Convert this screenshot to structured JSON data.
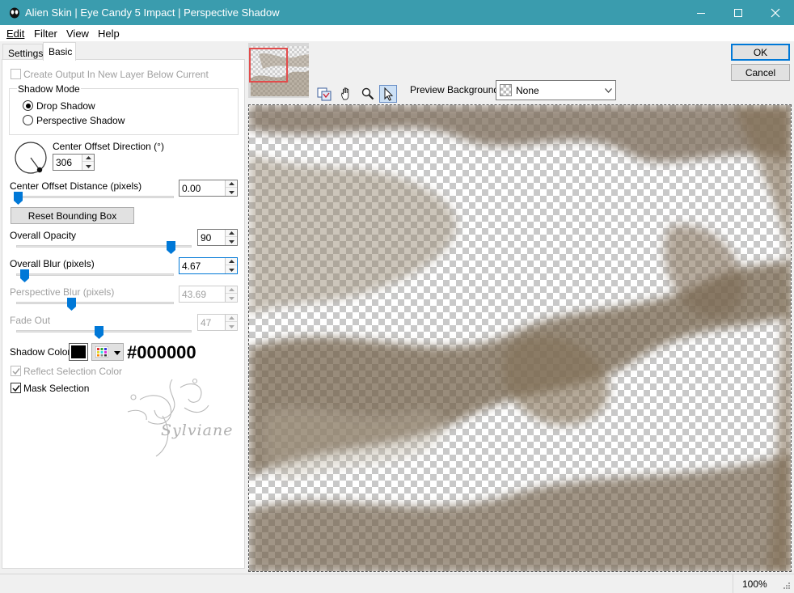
{
  "window": {
    "title": "Alien Skin | Eye Candy 5 Impact | Perspective Shadow",
    "titlebar_color": "#3a9cae"
  },
  "menu": {
    "items": [
      {
        "label": "Edit"
      },
      {
        "label": "Filter"
      },
      {
        "label": "View"
      },
      {
        "label": "Help"
      }
    ]
  },
  "tabs": [
    {
      "label": "Settings",
      "active": false
    },
    {
      "label": "Basic",
      "active": true
    }
  ],
  "basic": {
    "create_output_label": "Create Output In New Layer Below Current",
    "create_output_checked": false,
    "shadow_mode": {
      "group_label": "Shadow Mode",
      "options": [
        {
          "label": "Drop Shadow",
          "selected": true
        },
        {
          "label": "Perspective Shadow",
          "selected": false
        }
      ]
    },
    "center_offset_direction": {
      "label": "Center Offset Direction (°)",
      "value": "306"
    },
    "center_offset_distance": {
      "label": "Center Offset Distance (pixels)",
      "value": "0.00",
      "level": 0.0
    },
    "reset_bounding_box_label": "Reset Bounding Box",
    "overall_opacity": {
      "label": "Overall Opacity",
      "value": "90",
      "level": 0.9
    },
    "overall_blur": {
      "label": "Overall Blur (pixels)",
      "value": "4.67",
      "level": 0.05
    },
    "perspective_blur": {
      "label": "Perspective Blur (pixels)",
      "value": "43.69",
      "level": 0.35,
      "enabled": false
    },
    "fade_out": {
      "label": "Fade Out",
      "value": "47",
      "level": 0.47,
      "enabled": false
    },
    "shadow_color": {
      "label": "Shadow Color",
      "value": "#000000",
      "hex_text": "#000000"
    },
    "reflect_selection_color": {
      "label": "Reflect Selection Color",
      "checked": true,
      "enabled": false
    },
    "mask_selection": {
      "label": "Mask Selection",
      "checked": true
    },
    "watermark_text": "Sylviane"
  },
  "buttons": {
    "ok_label": "OK",
    "cancel_label": "Cancel"
  },
  "preview": {
    "background_label": "Preview Background:",
    "background_value": "None",
    "tools": [
      "preview-toggle-icon",
      "hand-icon",
      "zoom-icon",
      "arrow-pointer-icon"
    ],
    "active_tool": "arrow-pointer-icon",
    "sepia_color": "#7a6a55"
  },
  "status": {
    "zoom": "100%"
  }
}
